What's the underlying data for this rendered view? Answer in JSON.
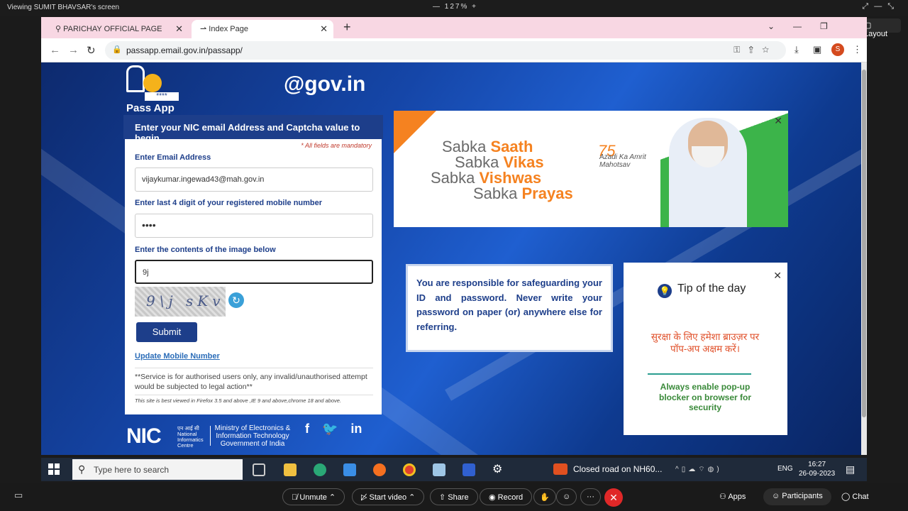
{
  "zoom": {
    "viewing": "Viewing SUMIT BHAVSAR's screen",
    "zoom_level": "127%",
    "layout_label": "Layout",
    "buttons": {
      "unmute": "Unmute",
      "start_video": "Start video",
      "share": "Share",
      "record": "Record",
      "apps": "Apps",
      "participants": "Participants",
      "chat": "Chat"
    }
  },
  "browser": {
    "tabs": [
      {
        "label": "PARICHAY OFFICIAL PAGE"
      },
      {
        "label": "Index Page"
      }
    ],
    "url": "passapp.email.gov.in/passapp/",
    "profile_initial": "S"
  },
  "page": {
    "logo_text": "Pass App",
    "logo_stars": "****",
    "gov_logo": "@gov.in",
    "panel_heading": "Enter your NIC email Address and Captcha value to begin",
    "mandatory_note": "* All fields are mandatory",
    "email_label": "Enter Email Address",
    "email_value": "vijaykumar.ingewad43@mah.gov.in",
    "mobile_label": "Enter last 4 digit of your registered mobile number",
    "mobile_value": "••••",
    "captcha_label": "Enter the contents of the image below",
    "captcha_input": "9j",
    "captcha_image_text": "9\\j sKv",
    "submit_label": "Submit",
    "update_link": "Update Mobile Number",
    "service_note": "**Service is for authorised users only, any invalid/unauthorised attempt would be subjected to legal action**",
    "best_view": "This site is best viewed in Firefox 3.5 and above ,IE 9 and above,chrome 18 and above.",
    "banner": {
      "lines": [
        {
          "prefix": "Sabka ",
          "word": "Saath"
        },
        {
          "prefix": "Sabka ",
          "word": "Vikas"
        },
        {
          "prefix": "Sabka ",
          "word": "Vishwas"
        },
        {
          "prefix": "Sabka ",
          "word": "Prayas"
        }
      ],
      "amrit_num": "75",
      "amrit_text": "Azadi Ka Amrit Mahotsav"
    },
    "responsibility": "You are responsible for safeguarding your ID and password. Never write your password on paper (or) anywhere else for referring.",
    "tip": {
      "title": "Tip of the day",
      "hindi": "सुरक्षा के लिए हमेशा ब्राउज़र पर पॉप-अप अक्षम करें।",
      "english": "Always enable pop-up blocker on browser for security"
    },
    "nic": {
      "logo": "NIC",
      "small": "एन आई सी National Informatics Centre",
      "ministry": "Ministry of Electronics & Information Technology Government of India"
    }
  },
  "taskbar": {
    "search_placeholder": "Type here to search",
    "news": "Closed road on NH60...",
    "lang": "ENG",
    "time": "16:27",
    "date": "26-09-2023"
  }
}
